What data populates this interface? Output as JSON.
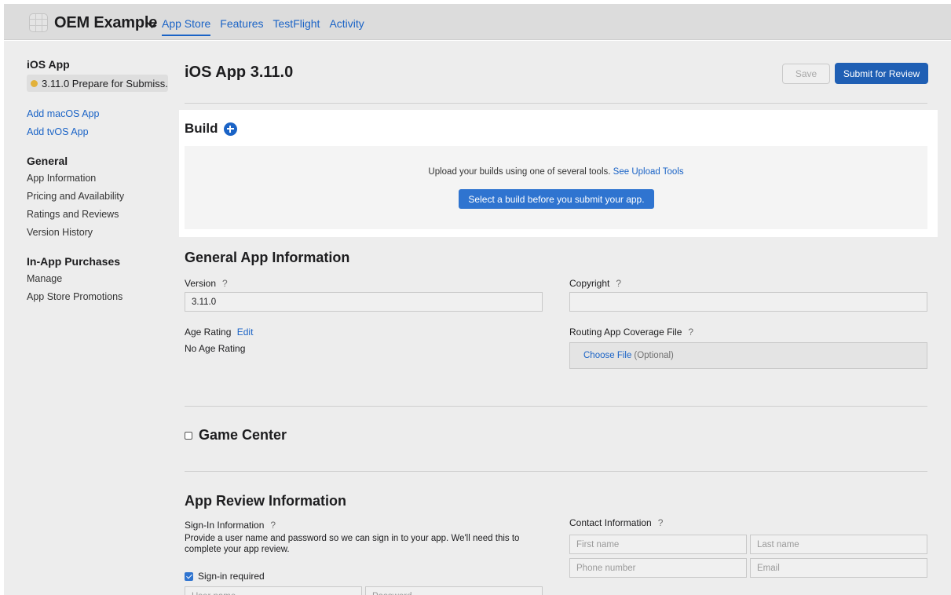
{
  "topbar": {
    "org_name": "OEM Example",
    "tabs": [
      "App Store",
      "Features",
      "TestFlight",
      "Activity"
    ]
  },
  "sidebar": {
    "app_title": "iOS App",
    "version_status": "3.11.0 Prepare for Submiss...",
    "add_links": [
      "Add macOS App",
      "Add tvOS App"
    ],
    "general_heading": "General",
    "general_items": [
      "App Information",
      "Pricing and Availability",
      "Ratings and Reviews",
      "Version History"
    ],
    "iap_heading": "In-App Purchases",
    "iap_items": [
      "Manage",
      "App Store Promotions"
    ]
  },
  "header": {
    "title": "iOS App 3.11.0",
    "save_label": "Save",
    "submit_label": "Submit for Review"
  },
  "build": {
    "title": "Build",
    "upload_text": "Upload your builds using one of several tools.",
    "upload_link": "See Upload Tools",
    "select_button": "Select a build before you submit your app."
  },
  "general_info": {
    "title": "General App Information",
    "version_label": "Version",
    "version_value": "3.11.0",
    "copyright_label": "Copyright",
    "copyright_value": "",
    "age_rating_label": "Age Rating",
    "age_rating_edit": "Edit",
    "age_rating_value": "No Age Rating",
    "routing_label": "Routing App Coverage File",
    "choose_file": "Choose File",
    "optional": "(Optional)",
    "help_glyph": "?"
  },
  "game_center": {
    "title": "Game Center"
  },
  "review_info": {
    "title": "App Review Information",
    "signin_label": "Sign-In Information",
    "signin_desc": "Provide a user name and password so we can sign in to your app. We'll need this to complete your app review.",
    "signin_required": "Sign-in required",
    "username_placeholder": "User name",
    "password_placeholder": "Password",
    "contact_label": "Contact Information",
    "first_name_placeholder": "First name",
    "last_name_placeholder": "Last name",
    "phone_placeholder": "Phone number",
    "email_placeholder": "Email"
  },
  "colors": {
    "accent": "#1a63c6",
    "submit_button": "#1f5fb4",
    "status_dot": "#e2b13a"
  }
}
